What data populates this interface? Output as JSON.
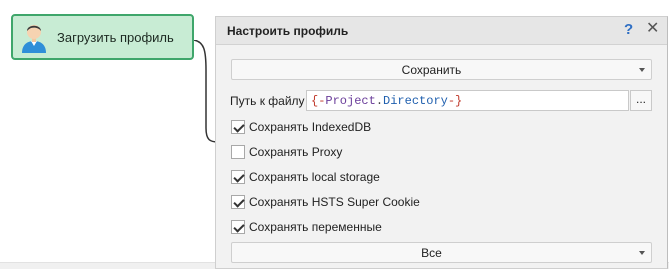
{
  "node": {
    "label": "Загрузить профиль",
    "icon": "user-avatar-icon"
  },
  "panel": {
    "title": "Настроить профиль",
    "help_symbol": "?",
    "close_symbol": "✕",
    "action_dropdown": "Сохранить",
    "path": {
      "label": "Путь к файлу",
      "brace_open": "{-",
      "project": "Project",
      "dot": ".",
      "directory": "Directory",
      "brace_close": "-}",
      "browse_label": "..."
    },
    "options": [
      {
        "label": "Сохранять IndexedDB",
        "checked": true
      },
      {
        "label": "Сохранять Proxy",
        "checked": false
      },
      {
        "label": "Сохранять local storage",
        "checked": true
      },
      {
        "label": "Сохранять HSTS Super Cookie",
        "checked": true
      },
      {
        "label": "Сохранять переменные",
        "checked": true
      }
    ],
    "variables_dropdown": "Все"
  },
  "colors": {
    "node_bg": "#c8ecd4",
    "node_border": "#3fa66b",
    "panel_bg": "#f2f2f2",
    "help": "#2f6fc4"
  }
}
